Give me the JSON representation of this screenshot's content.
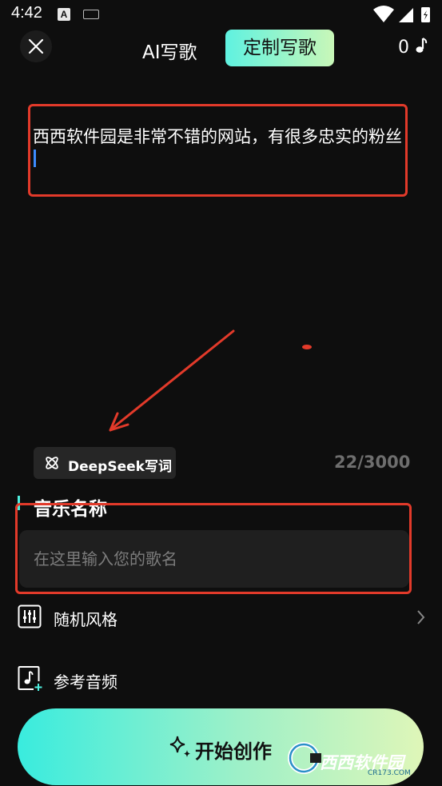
{
  "status": {
    "time": "4:42",
    "a_badge": "A"
  },
  "header": {
    "tab_ai": "AI写歌",
    "tab_custom": "定制写歌",
    "credits": "0"
  },
  "lyrics": {
    "text": "西西软件园是非常不错的网站，有很多忠实的粉丝"
  },
  "deepseek": {
    "label": "DeepSeek写词",
    "count": "22/3000"
  },
  "song_name": {
    "title": "音乐名称",
    "placeholder": "在这里输入您的歌名",
    "value": ""
  },
  "options": {
    "random_style": "随机风格",
    "reference_audio": "参考音频"
  },
  "create": {
    "label": "开始创作"
  },
  "watermark": {
    "text": "西西软件园",
    "sub": "CR173.COM"
  },
  "colors": {
    "accent": "#4ff0e0",
    "annotation": "#e23a2a",
    "cursor": "#3d8bff"
  }
}
